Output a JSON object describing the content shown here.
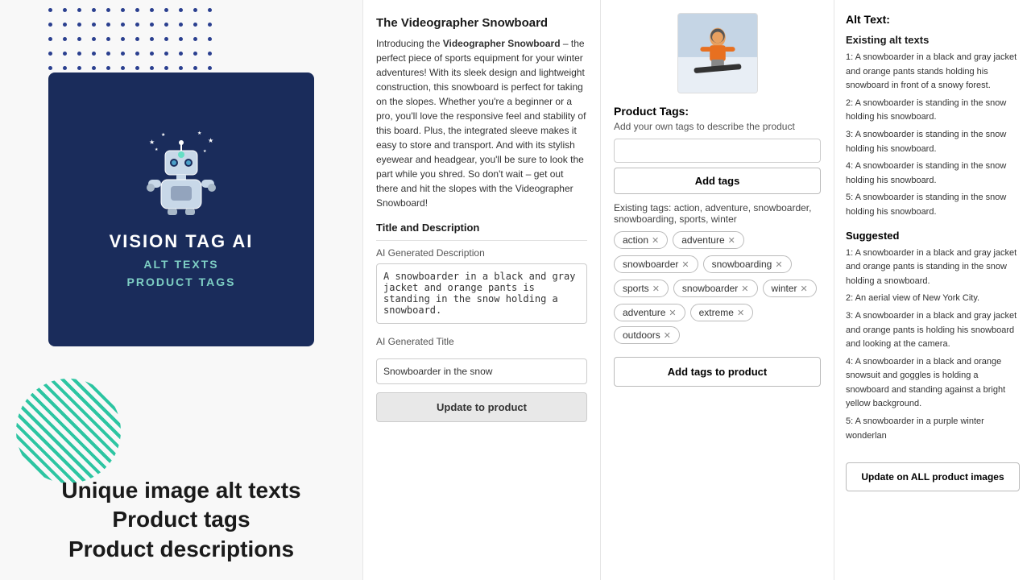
{
  "dots": {
    "rows": 7,
    "cols": 12
  },
  "logo": {
    "title": "VISION TAG AI",
    "subtitle_line1": "ALT TEXTS",
    "subtitle_line2": "PRODUCT TAGS"
  },
  "tagline": {
    "line1": "Unique image alt texts",
    "line2": "Product tags",
    "line3": "Product descriptions"
  },
  "product": {
    "title": "The Videographer Snowboard",
    "description_intro": "Introducing the ",
    "description_bold": "Videographer Snowboard",
    "description_rest": " – the perfect piece of sports equipment for your winter adventures! With its sleek design and lightweight construction, this snowboard is perfect for taking on the slopes. Whether you're a beginner or a pro, you'll love the responsive feel and stability of this board. Plus, the integrated sleeve makes it easy to store and transport. And with its stylish eyewear and headgear, you'll be sure to look the part while you shred. So don't wait – get out there and hit the slopes with the Videographer Snowboard!",
    "title_and_desc_label": "Title and Description",
    "ai_desc_label": "AI Generated Description",
    "ai_desc_value": "A snowboarder in a black and gray jacket and orange pants is standing in the snow holding a snowboard.",
    "ai_title_label": "AI Generated Title",
    "ai_title_value": "Snowboarder in the snow",
    "update_btn_label": "Update to product"
  },
  "tags": {
    "title": "Product Tags:",
    "description": "Add your own tags to describe the product",
    "input_placeholder": "",
    "add_btn_label": "Add tags",
    "existing_label": "Existing tags: action, adventure, snowboarder, snowboarding, sports, winter",
    "chips": [
      {
        "label": "action",
        "id": "tag-action"
      },
      {
        "label": "adventure",
        "id": "tag-adventure"
      },
      {
        "label": "snowboarder",
        "id": "tag-snowboarder"
      },
      {
        "label": "snowboarding",
        "id": "tag-snowboarding"
      },
      {
        "label": "sports",
        "id": "tag-sports"
      },
      {
        "label": "snowboarder",
        "id": "tag-snowboarder2"
      },
      {
        "label": "winter",
        "id": "tag-winter"
      },
      {
        "label": "adventure",
        "id": "tag-adventure2"
      },
      {
        "label": "extreme",
        "id": "tag-extreme"
      },
      {
        "label": "outdoors",
        "id": "tag-outdoors"
      }
    ],
    "add_to_product_btn": "Add tags to product"
  },
  "alt_text": {
    "title": "Alt Text:",
    "existing_subtitle": "Existing alt texts",
    "existing_items": [
      "1: A snowboarder in a black and gray jacket and orange pants stands holding his snowboard in front of a snowy forest.",
      "2: A snowboarder is standing in the snow holding his snowboard.",
      "3: A snowboarder is standing in the snow holding his snowboard.",
      "4: A snowboarder is standing in the snow holding his snowboard.",
      "5: A snowboarder is standing in the snow holding his snowboard."
    ],
    "suggested_subtitle": "Suggested",
    "suggested_items": [
      "1: A snowboarder in a black and gray jacket and orange pants is standing in the snow holding a snowboard.",
      "2: An aerial view of New York City.",
      "3: A snowboarder in a black and gray jacket and orange pants is holding his snowboard and looking at the camera.",
      "4: A snowboarder in a black and orange snowsuit and goggles is holding a snowboard and standing against a bright yellow background.",
      "5: A snowboarder in a purple winter wonderlan"
    ],
    "update_all_btn": "Update on ALL product images"
  }
}
